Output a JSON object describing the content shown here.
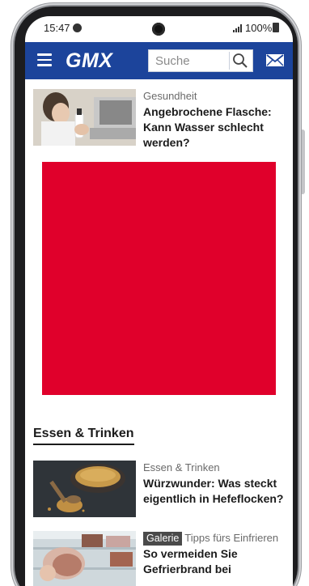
{
  "status_bar": {
    "time": "15:47",
    "battery": "100%"
  },
  "header": {
    "logo": "GMX",
    "search_placeholder": "Suche"
  },
  "articles": [
    {
      "category": "Gesundheit",
      "title": "Angebrochene Flasche: Kann Wasser schlecht werden?"
    },
    {
      "category": "Essen & Trinken",
      "title": "Würzwunder: Was steckt eigentlich in Hefeflocken?"
    },
    {
      "badge": "Galerie",
      "category": "Tipps fürs Einfrieren",
      "title": "So vermeiden Sie Gefrierbrand bei"
    }
  ],
  "section": {
    "title": "Essen & Trinken"
  },
  "colors": {
    "header_bg": "#1c449b",
    "ad_block": "#e0002b"
  },
  "icons": [
    "menu-icon",
    "search-icon",
    "mail-icon",
    "signal-icon",
    "battery-icon"
  ]
}
